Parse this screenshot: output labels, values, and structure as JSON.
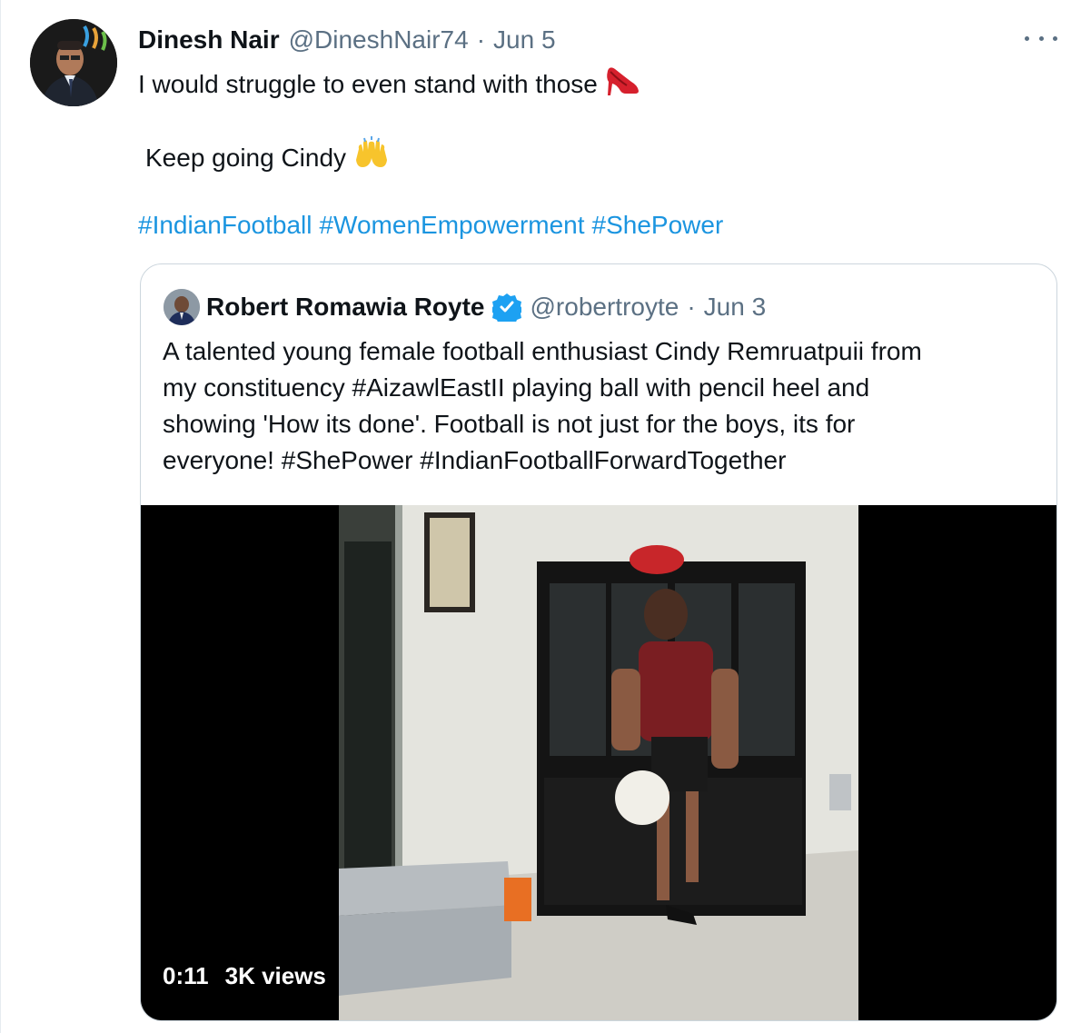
{
  "tweet": {
    "display_name": "Dinesh Nair",
    "handle": "@DineshNair74",
    "separator": "·",
    "date": "Jun 5",
    "line1": "I would struggle to even stand with those",
    "line1_emoji": "👠",
    "line2": "Keep going Cindy",
    "line2_emoji": "🙌",
    "hashtags": [
      "#IndianFootball",
      "#WomenEmpowerment",
      "#ShePower"
    ]
  },
  "quoted_tweet": {
    "display_name": "Robert Romawia Royte",
    "handle": "@robertroyte",
    "separator": "·",
    "date": "Jun 3",
    "text_lines": [
      "A talented young female football enthusiast Cindy Remruatpuii from",
      "my constituency #AizawlEastII playing ball with pencil heel and",
      "showing 'How its done'. Football is not just for the boys, its for",
      "everyone! #ShePower #IndianFootballForwardTogether"
    ],
    "video": {
      "duration": "0:11",
      "views": "3K views"
    }
  },
  "colors": {
    "text": "#0f1419",
    "secondary": "#5b7083",
    "link": "#1b95e0",
    "verified": "#1da1f2",
    "border": "#ccd6dd"
  },
  "icons": {
    "more": "more-horizontal-icon",
    "verified": "verified-badge-icon"
  }
}
